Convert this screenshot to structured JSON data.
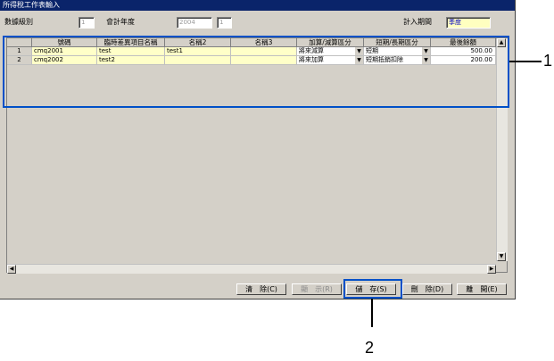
{
  "window": {
    "title": "所得稅工作表輸入"
  },
  "form": {
    "data_level_label": "數據級別",
    "data_level_value": "1",
    "fiscal_year_label": "會計年度",
    "fiscal_year_value": "2004",
    "fiscal_year_period": "1",
    "booking_period_label": "計入期間",
    "booking_period_value": "季度"
  },
  "grid": {
    "headers": [
      "號碼",
      "臨時差異項目名稱",
      "名稱2",
      "名稱3",
      "加算/減算區分",
      "短期/長期區分",
      "最後餘額"
    ],
    "rows": [
      {
        "no": "1",
        "code": "cmq2001",
        "name": "test",
        "name2": "test1",
        "name3": "",
        "add_sub": "將來減算",
        "term": "短期",
        "balance": "500.00"
      },
      {
        "no": "2",
        "code": "cmq2002",
        "name": "test2",
        "name2": "",
        "name3": "",
        "add_sub": "將來加算",
        "term": "短期抵銷扣除",
        "balance": "200.00"
      }
    ]
  },
  "buttons": {
    "clear": "清　除(C)",
    "display": "顯　示(R)",
    "save": "儲　存(S)",
    "delete": "刪　除(D)",
    "close": "離　開(E)"
  },
  "callouts": {
    "one": "1",
    "two": "2"
  },
  "colors": {
    "callout": "#0050c8",
    "titlebar": "#0a246a",
    "row_highlight": "#ffffc8"
  }
}
